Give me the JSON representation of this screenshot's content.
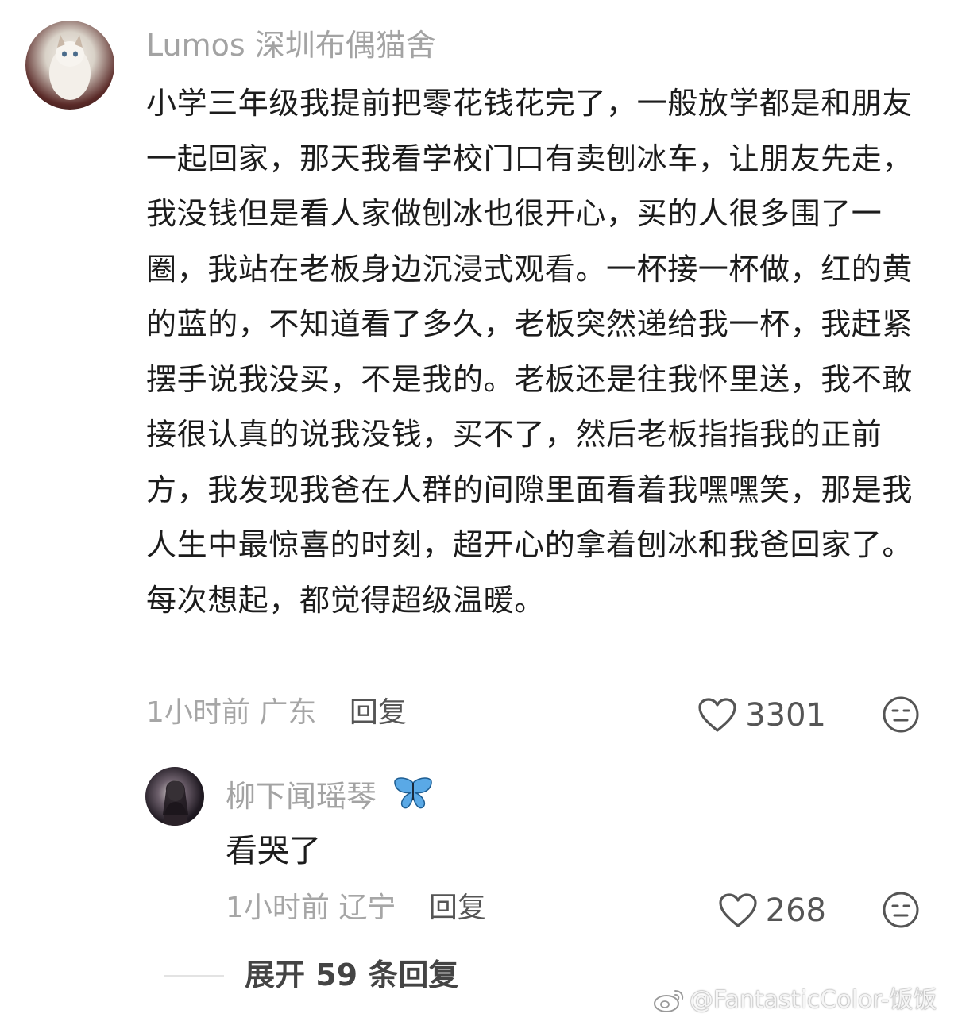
{
  "main_comment": {
    "username": "Lumos 深圳布偶猫舍",
    "body": "小学三年级我提前把零花钱花完了，一般放学都是和朋友一起回家，那天我看学校门口有卖刨冰车，让朋友先走，我没钱但是看人家做刨冰也很开心，买的人很多围了一圈，我站在老板身边沉浸式观看。一杯接一杯做，红的黄的蓝的，不知道看了多久，老板突然递给我一杯，我赶紧摆手说我没买，不是我的。老板还是往我怀里送，我不敢接很认真的说我没钱，买不了，然后老板指指我的正前方，我发现我爸在人群的间隙里面看着我嘿嘿笑，那是我人生中最惊喜的时刻，超开心的拿着刨冰和我爸回家了。每次想起，都觉得超级温暖。",
    "time": "1小时前",
    "location": "广东",
    "reply_label": "回复",
    "like_count": "3301"
  },
  "reply_comment": {
    "username": "柳下闻瑶琴",
    "username_emoji": "🦋",
    "body": "看哭了",
    "time": "1小时前",
    "location": "辽宁",
    "reply_label": "回复",
    "like_count": "268"
  },
  "expand": {
    "label": "展开 59 条回复"
  },
  "watermark": {
    "text": "@FantasticColor-饭饭"
  }
}
